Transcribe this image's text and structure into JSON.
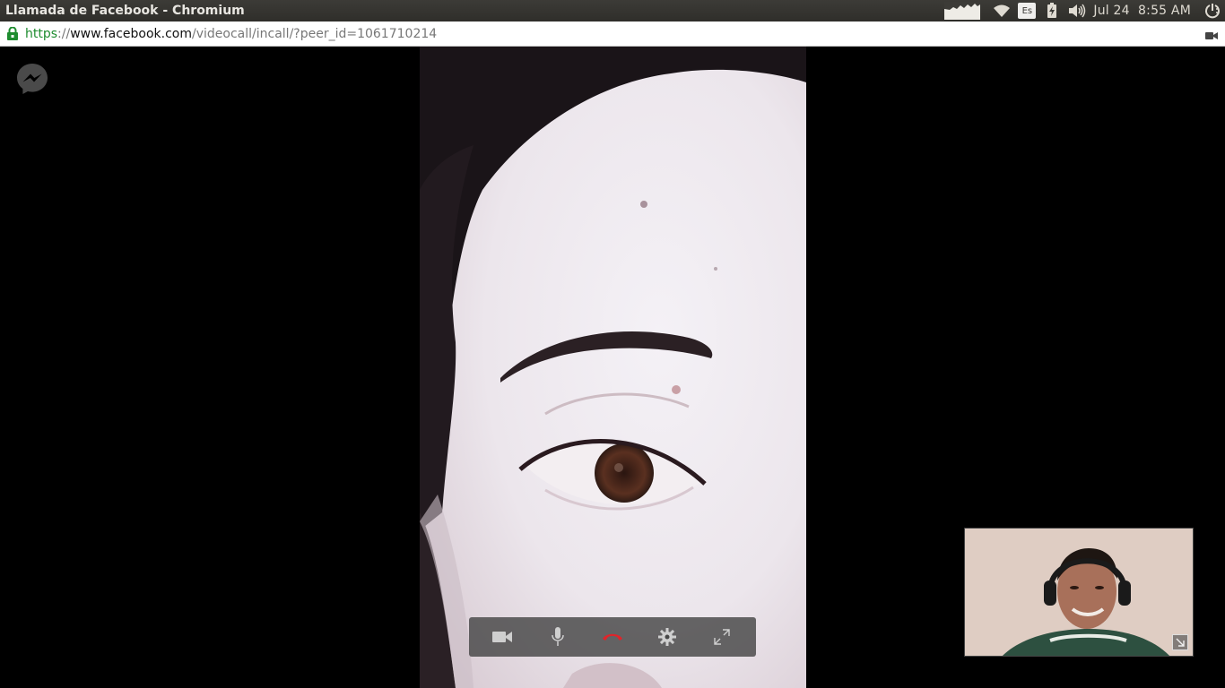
{
  "window": {
    "title": "Llamada de Facebook - Chromium"
  },
  "panel": {
    "keyboard_layout": "Es",
    "date": "Jul 24",
    "time": "8:55 AM",
    "icons": [
      "cpu-graph-icon",
      "wifi-icon",
      "battery-charging-icon",
      "volume-icon",
      "power-icon"
    ]
  },
  "address": {
    "scheme": "https",
    "separator": "://",
    "host": "www.facebook.com",
    "path": "/videocall/incall/?peer_id=1061710214"
  },
  "call": {
    "controls": [
      "video-camera-icon",
      "microphone-icon",
      "hang-up-icon",
      "settings-icon",
      "fullscreen-icon"
    ],
    "hang_up_color": "#e0242a",
    "messenger_icon_color": "#4a4a4a"
  }
}
